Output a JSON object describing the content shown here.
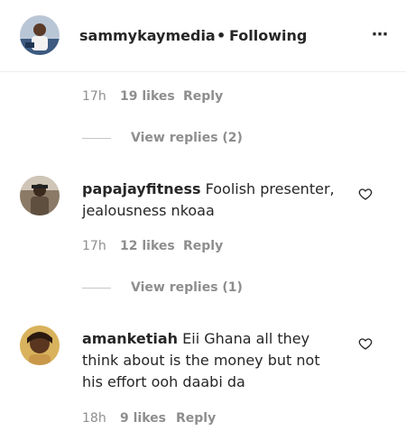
{
  "post": {
    "author": "sammykaymedia",
    "separator": "•",
    "follow_status": "Following",
    "more_icon": "⋯"
  },
  "top_reply_meta": {
    "time": "17h",
    "likes": "19 likes",
    "reply": "Reply"
  },
  "top_view_replies": "View replies (2)",
  "comments": [
    {
      "username": "papajayfitness",
      "text": "Foolish presenter,",
      "text2": "jealousness nkoaa",
      "time": "17h",
      "likes": "12 likes",
      "reply": "Reply",
      "view_replies": "View replies (1)"
    },
    {
      "username": "amanketiah",
      "text": "Eii Ghana all they",
      "text2": "think about is the money but not",
      "text3": "his effort ooh daabi da",
      "time": "18h",
      "likes": "9 likes",
      "reply": "Reply"
    }
  ],
  "icons": {
    "like": "heart-icon",
    "more": "more-horizontal-icon"
  }
}
